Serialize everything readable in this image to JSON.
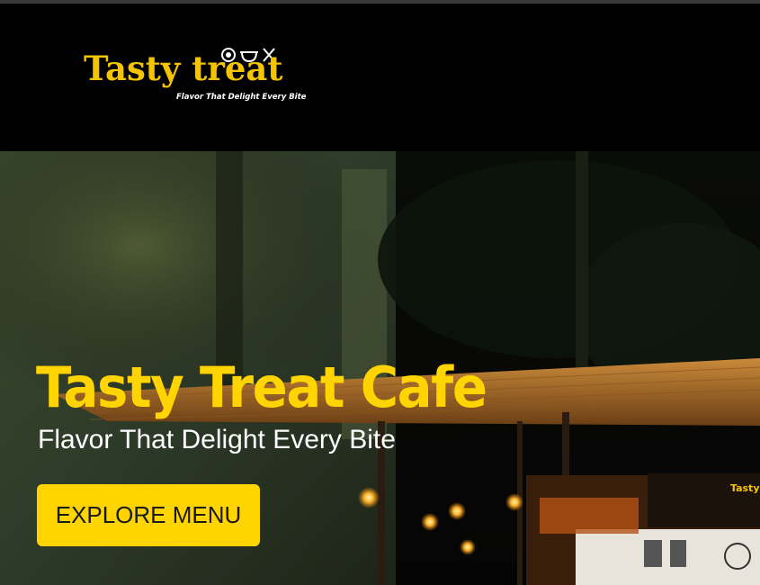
{
  "header": {
    "logo": {
      "name": "Tasty treat",
      "tagline": "Flavor That Delight Every Bite"
    }
  },
  "hero": {
    "title": "Tasty Treat Cafe",
    "subtitle": "Flavor That Delight Every Bite",
    "cta_label": "EXPLORE MENU",
    "background_icon": "night-cafe-photo"
  },
  "colors": {
    "accent": "#ffd400",
    "header_bg": "#000000",
    "logo_text": "#f5c400",
    "subtitle_text": "#ffffff",
    "button_text": "#1a1a1a"
  }
}
